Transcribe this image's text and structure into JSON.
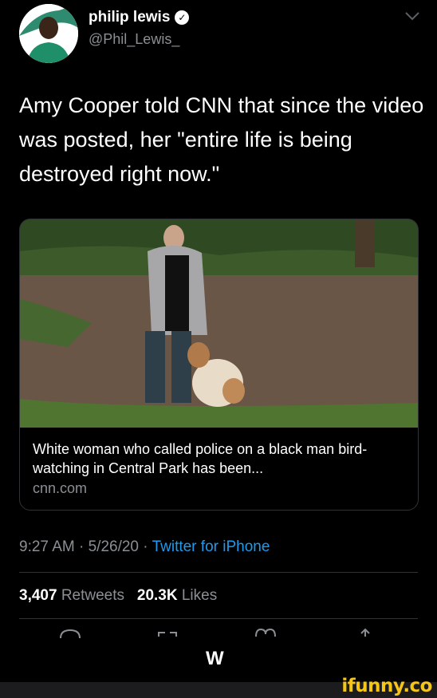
{
  "user": {
    "display_name": "philip lewis",
    "handle": "@Phil_Lewis_",
    "verified": true
  },
  "tweet": {
    "text": "Amy Cooper told CNN that since the video was posted, her \"entire life is being destroyed right now.\""
  },
  "card": {
    "title": "White woman who called police on a black man bird-watching in Central Park has been...",
    "domain": "cnn.com"
  },
  "meta": {
    "time": "9:27 AM",
    "date": "5/26/20",
    "separator": "·",
    "source": "Twitter for iPhone"
  },
  "stats": {
    "retweets_count": "3,407",
    "retweets_label": "Retweets",
    "likes_count": "20.3K",
    "likes_label": "Likes"
  },
  "bottom_text": "W",
  "watermark": "ifunny.co",
  "icons": [
    "verified-icon",
    "chevron-down-icon",
    "reply-icon",
    "retweet-icon",
    "like-icon",
    "share-icon"
  ],
  "colors": {
    "link": "#1d9bf0",
    "muted": "#8b8f94",
    "watermark": "#f5c518"
  }
}
